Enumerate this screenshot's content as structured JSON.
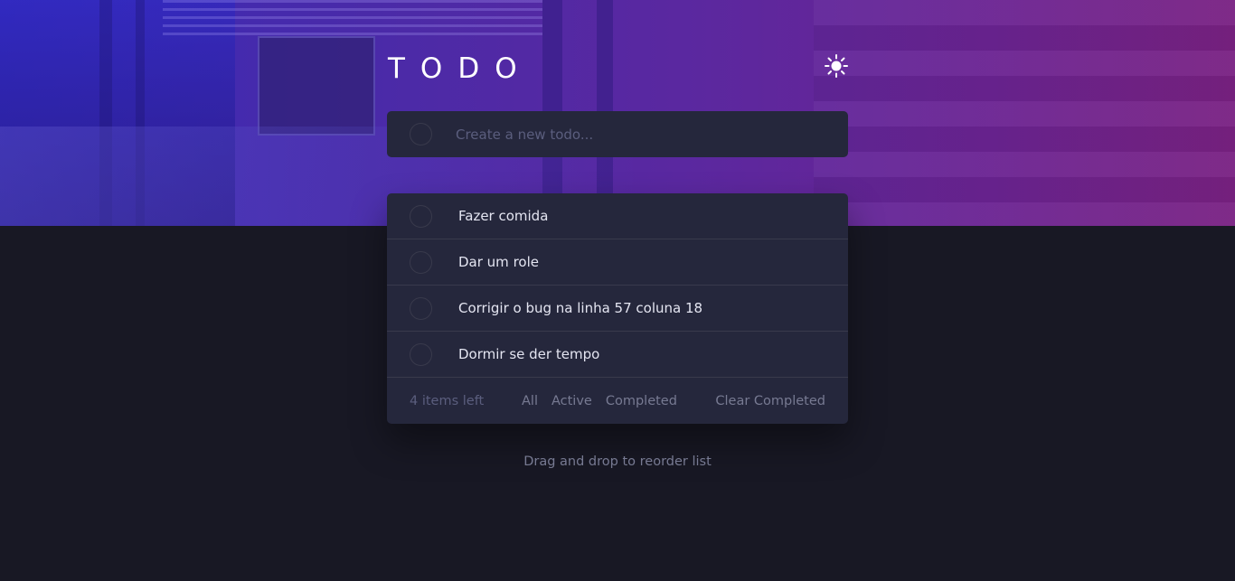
{
  "header": {
    "title": "TODO",
    "theme_icon": "sun-icon"
  },
  "new_todo": {
    "placeholder": "Create a new todo...",
    "value": ""
  },
  "todos": [
    {
      "label": "Fazer comida",
      "completed": false
    },
    {
      "label": "Dar um role",
      "completed": false
    },
    {
      "label": "Corrigir o bug na linha 57 coluna 18",
      "completed": false
    },
    {
      "label": "Dormir se der tempo",
      "completed": false
    }
  ],
  "footer": {
    "items_left": "4 items left",
    "filters": [
      "All",
      "Active",
      "Completed"
    ],
    "clear_label": "Clear Completed"
  },
  "hint": "Drag and drop to reorder list",
  "colors": {
    "background": "#181824",
    "card": "#25273c",
    "hero_start": "#3a2bb8",
    "hero_end": "#7a2283"
  }
}
